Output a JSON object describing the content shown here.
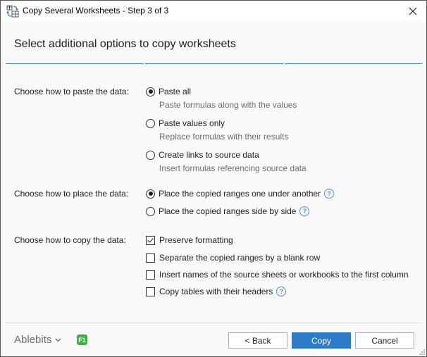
{
  "window": {
    "title": "Copy Several Worksheets - Step 3 of 3",
    "icon": "copy-worksheets-icon",
    "close_icon": "close-icon"
  },
  "header": {
    "title": "Select additional options to copy worksheets",
    "step_count": 3,
    "current_step": 3
  },
  "paste_group": {
    "label": "Choose how to paste the data:",
    "selected": "Paste all",
    "options": [
      {
        "label": "Paste all",
        "description": "Paste formulas along with the values",
        "checked": true
      },
      {
        "label": "Paste values only",
        "description": "Replace formulas with their results",
        "checked": false
      },
      {
        "label": "Create links to source data",
        "description": "Insert formulas referencing source data",
        "checked": false
      }
    ]
  },
  "place_group": {
    "label": "Choose how to place the data:",
    "selected": "Place the copied ranges one under another",
    "options": [
      {
        "label": "Place the copied ranges one under another",
        "checked": true,
        "help": true
      },
      {
        "label": "Place the copied ranges side by side",
        "checked": false,
        "help": true
      }
    ]
  },
  "copy_group": {
    "label": "Choose how to copy the data:",
    "options": [
      {
        "label": "Preserve formatting",
        "checked": true,
        "help": false
      },
      {
        "label": "Separate the copied ranges by a blank row",
        "checked": false,
        "help": false
      },
      {
        "label": "Insert names of the source sheets or workbooks to the first column",
        "checked": false,
        "help": false
      },
      {
        "label": "Copy tables with their headers",
        "checked": false,
        "help": true
      }
    ]
  },
  "help_glyph": "?",
  "footer": {
    "brand": "Ablebits",
    "brand_chevron": "⌄",
    "f1_label": "F1",
    "back_label": "< Back",
    "copy_label": "Copy",
    "cancel_label": "Cancel"
  },
  "colors": {
    "accent": "#2b7bc9",
    "step_line": "#3f7fc0",
    "help": "#4a90d9",
    "f1_badge": "#3cb43c"
  }
}
